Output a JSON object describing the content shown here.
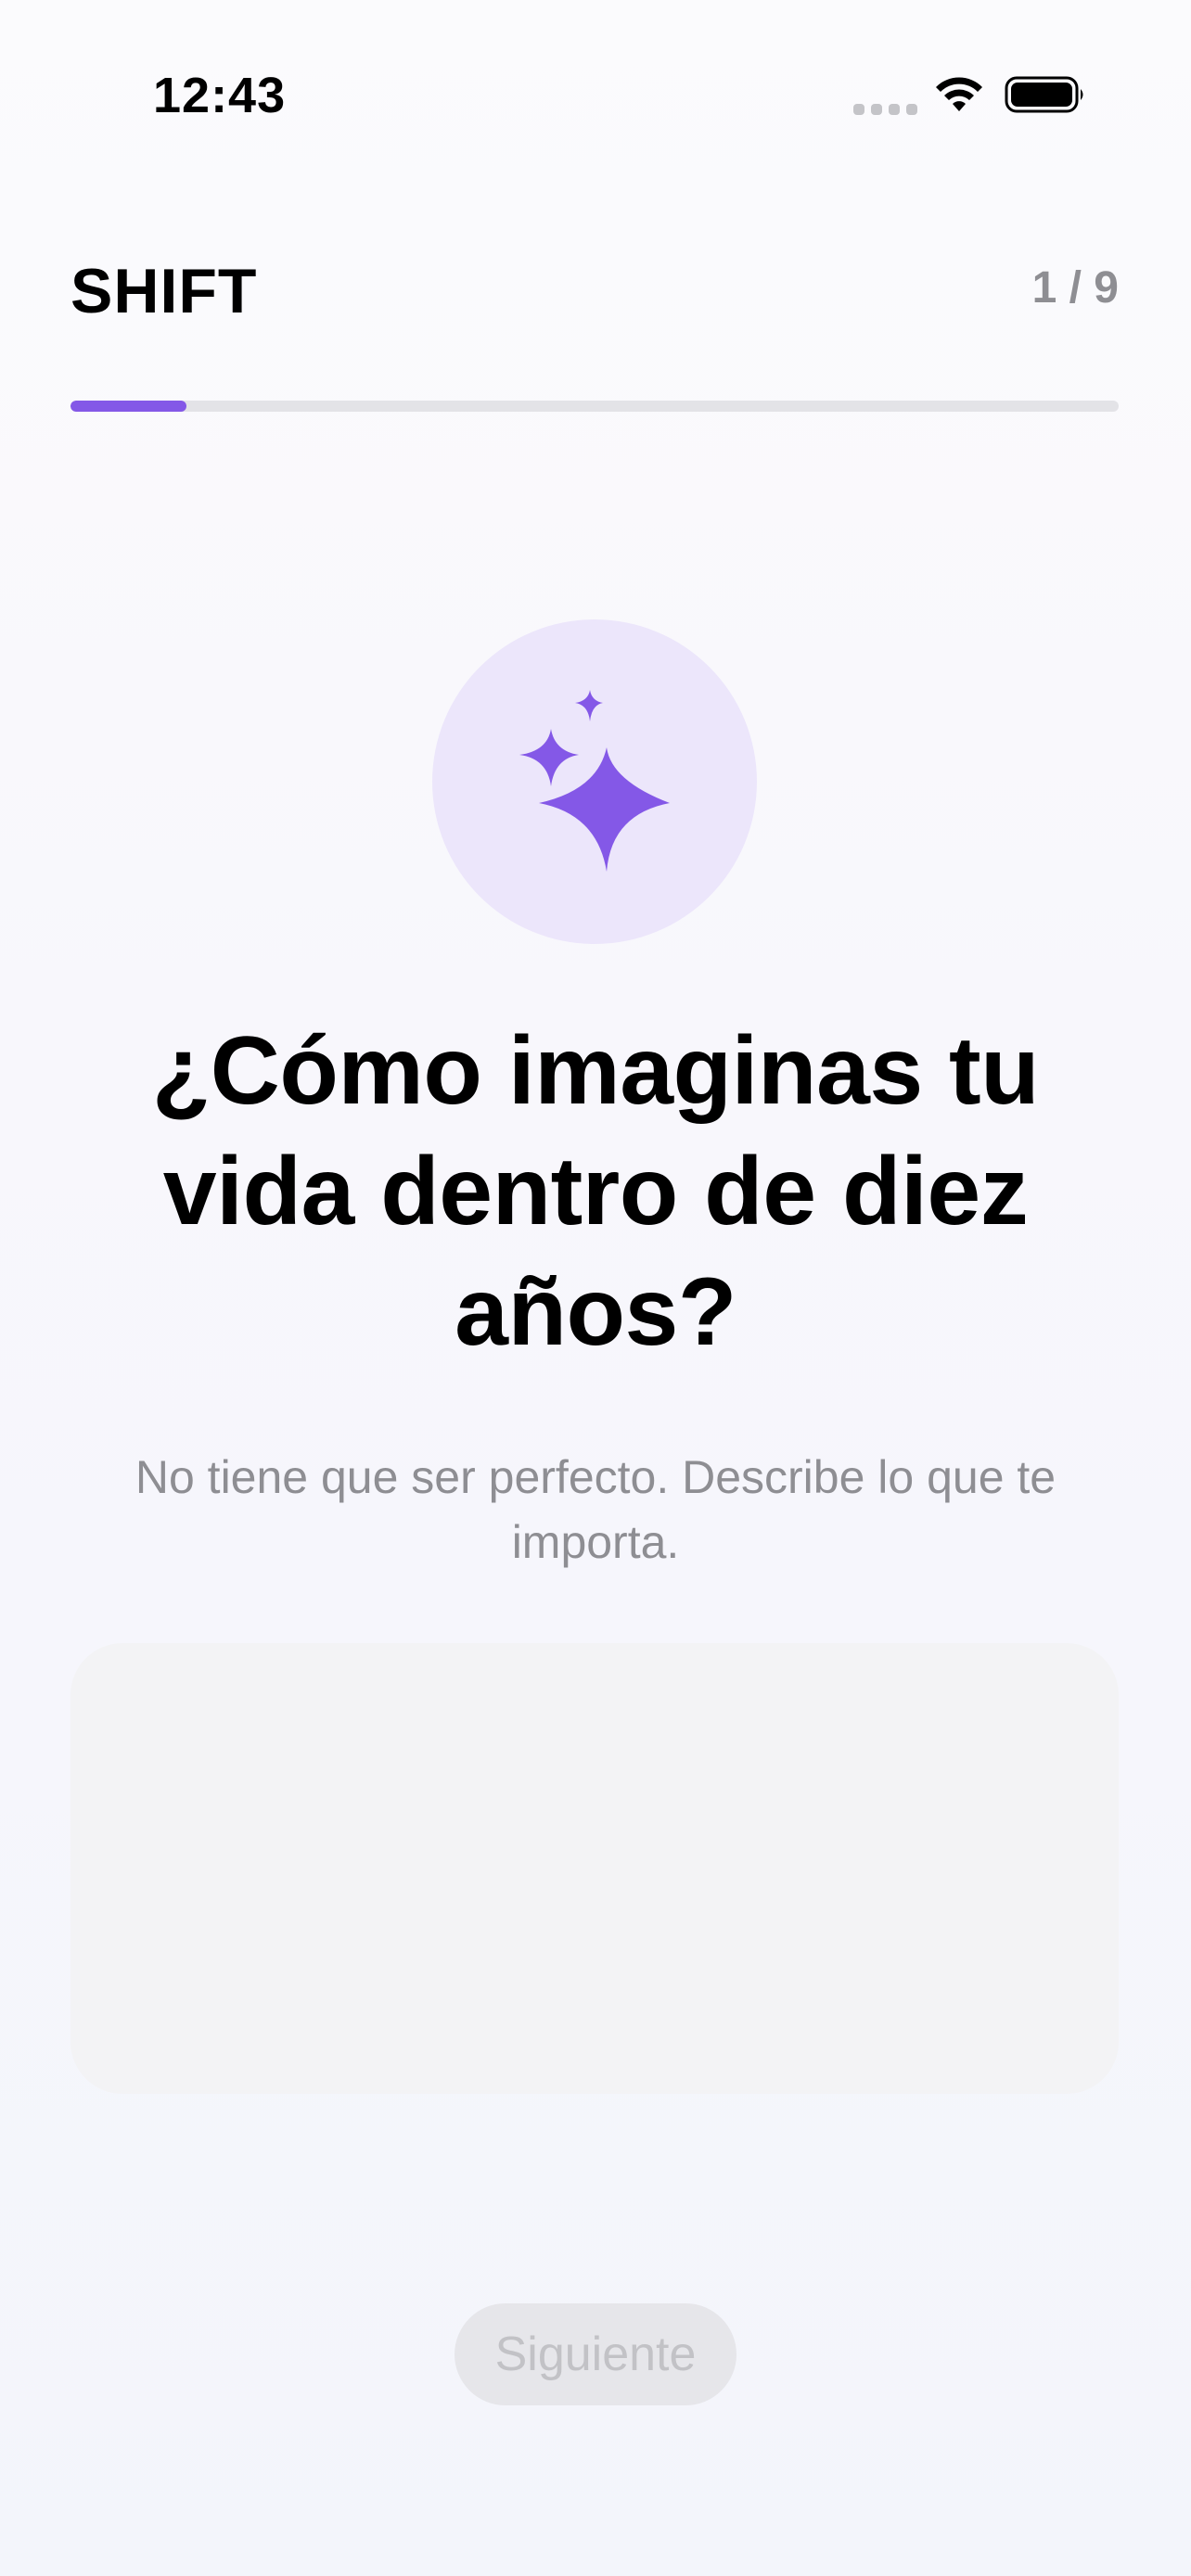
{
  "status_bar": {
    "time": "12:43"
  },
  "header": {
    "title": "SHIFT",
    "step_counter": "1 / 9"
  },
  "progress": {
    "fraction": 0.111
  },
  "hero": {
    "icon": "sparkles-icon",
    "circle_color": "#ece6fb",
    "icon_color": "#8458e7"
  },
  "question": {
    "title": "¿Cómo imaginas tu vida dentro de diez años?",
    "subtitle": "No tiene que ser perfecto. Describe lo que te importa."
  },
  "answer": {
    "value": "",
    "placeholder": ""
  },
  "footer": {
    "next_label": "Siguiente"
  },
  "colors": {
    "accent": "#8458e7",
    "secondary_text": "#8e8e93",
    "disabled_button": "#e6e6ea"
  }
}
